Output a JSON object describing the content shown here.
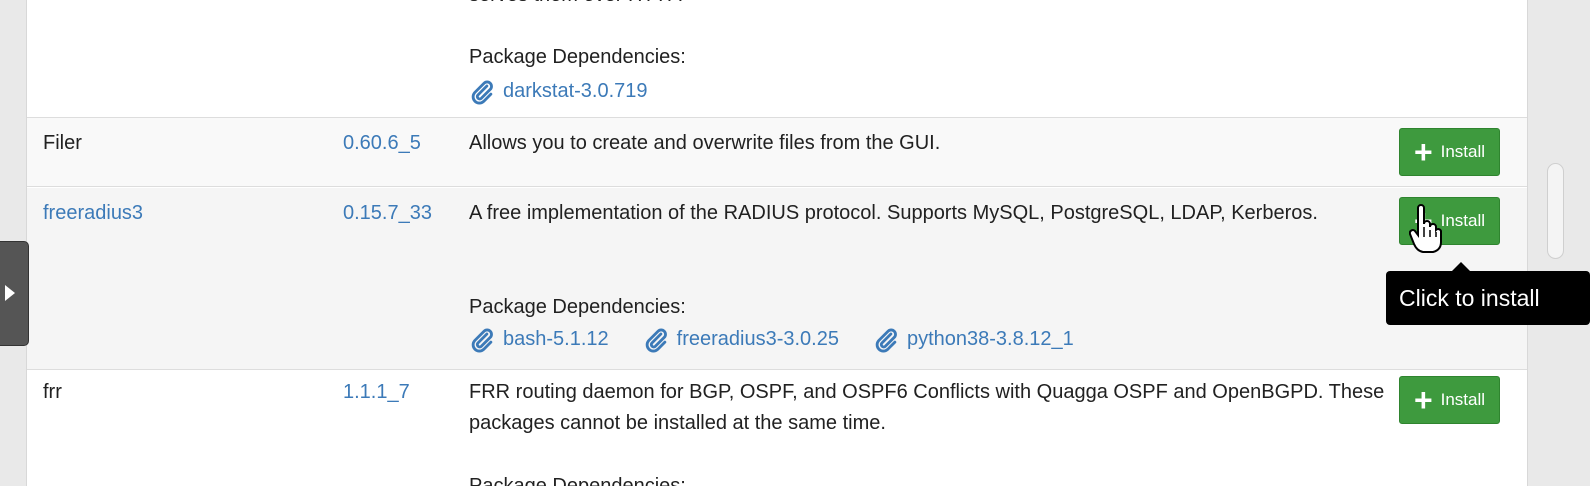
{
  "rows": [
    {
      "partial_top_text": "serves them over HTTP.",
      "dependencies_label": "Package Dependencies:",
      "dependencies": [
        "darkstat-3.0.719"
      ]
    },
    {
      "name": "Filer",
      "version": "0.60.6_5",
      "description": "Allows you to create and overwrite files from the GUI.",
      "install_label": "Install"
    },
    {
      "name": "freeradius3",
      "version": "0.15.7_33",
      "description": "A free implementation of the RADIUS protocol. Supports MySQL, PostgreSQL, LDAP, Kerberos.",
      "dependencies_label": "Package Dependencies:",
      "dependencies": [
        "bash-5.1.12",
        "freeradius3-3.0.25",
        "python38-3.8.12_1"
      ],
      "install_label": "Install"
    },
    {
      "name": "frr",
      "version": "1.1.1_7",
      "description": "FRR routing daemon for BGP, OSPF, and OSPF6 Conflicts with Quagga OSPF and OpenBGPD. These packages cannot be installed at the same time.",
      "dependencies_label": "Package Dependencies:",
      "install_label": "Install"
    }
  ],
  "tooltip": "Click to install",
  "icons": {
    "install": "plus-icon",
    "dependency": "paperclip-icon",
    "sidebar": "chevron-right-icon"
  },
  "colors": {
    "link": "#3c7ab8",
    "install_button": "#3e9a3e",
    "tooltip_bg": "#000000"
  }
}
